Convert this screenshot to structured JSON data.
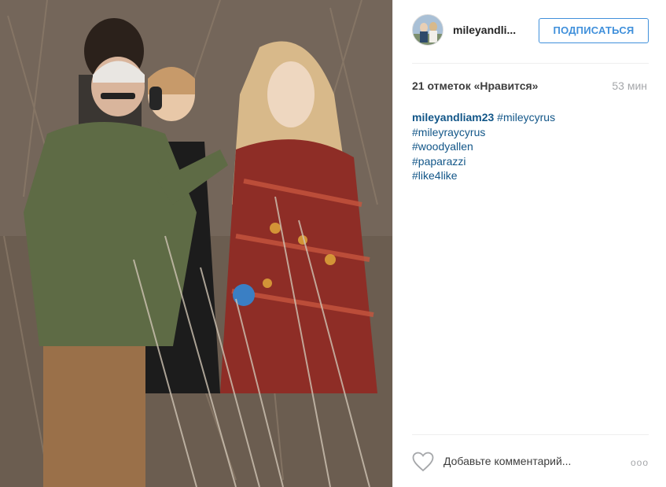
{
  "post": {
    "username": "mileyandli...",
    "follow_label": "ПОДПИСАТЬСЯ",
    "likes_text": "21 отметок «Нравится»",
    "time_ago": "53 мин",
    "caption": {
      "author": "mileyandliam23",
      "first_tag": "#mileycyrus",
      "tags": [
        "#mileyraycyrus",
        "#woodyallen",
        "#paparazzi",
        "#like4like"
      ]
    },
    "comment_placeholder": "Добавьте комментарий...",
    "more_label": "ooo"
  },
  "icons": {
    "like": "heart-outline-icon",
    "more": "more-options-icon"
  },
  "colors": {
    "link": "#125688",
    "follow_button": "#4090db",
    "muted": "#a5a7aa"
  }
}
